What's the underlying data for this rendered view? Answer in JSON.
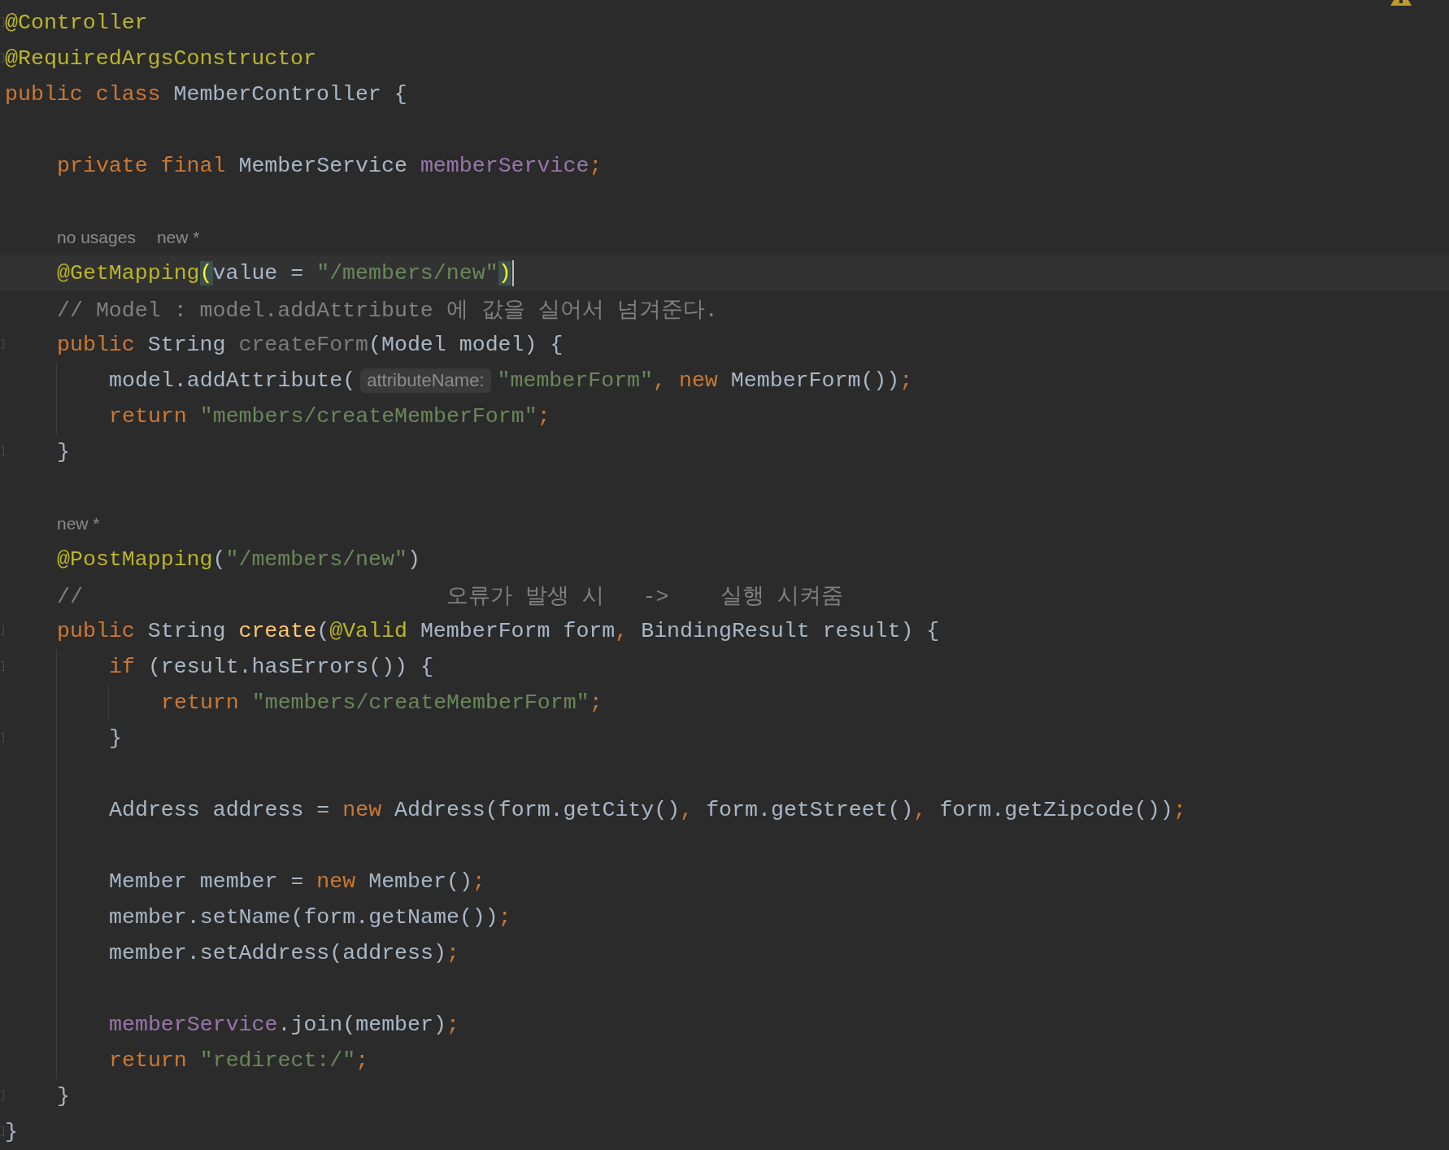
{
  "lines": [
    {
      "kind": "code",
      "fold": true,
      "tokens": [
        {
          "kind": "annotation",
          "text": "@Controller"
        }
      ]
    },
    {
      "kind": "code",
      "fold": true,
      "tokens": [
        {
          "kind": "annotation",
          "text": "@RequiredArgsConstructor"
        }
      ]
    },
    {
      "kind": "code",
      "tokens": [
        {
          "kind": "keyword",
          "text": "public class "
        },
        {
          "kind": "plain",
          "text": "MemberController {"
        }
      ],
      "children": [
        {
          "kind": "blank"
        },
        {
          "kind": "code",
          "tokens": [
            {
              "kind": "keyword",
              "text": "private final "
            },
            {
              "kind": "plain",
              "text": "MemberService "
            },
            {
              "kind": "field",
              "text": "memberService"
            },
            {
              "kind": "keyword",
              "text": ";"
            }
          ]
        },
        {
          "kind": "blank"
        },
        {
          "kind": "hint",
          "items": [
            "no usages",
            "new *"
          ]
        },
        {
          "kind": "code",
          "current": true,
          "tokens": [
            {
              "kind": "annotation",
              "text": "@GetMapping"
            },
            {
              "kind": "match",
              "text": "("
            },
            {
              "kind": "plain",
              "text": "value = "
            },
            {
              "kind": "string",
              "text": "\"/members/new\""
            },
            {
              "kind": "match",
              "text": ")"
            }
          ]
        },
        {
          "kind": "code",
          "tokens": [
            {
              "kind": "comment",
              "text": "// Model : model.addAttribute 에 값을 실어서 넘겨준다."
            }
          ]
        },
        {
          "kind": "code",
          "fold": true,
          "tokens": [
            {
              "kind": "keyword",
              "text": "public "
            },
            {
              "kind": "plain",
              "text": "String "
            },
            {
              "kind": "unused",
              "text": "createForm"
            },
            {
              "kind": "plain",
              "text": "(Model model) {"
            }
          ],
          "children": [
            {
              "kind": "code",
              "tokens": [
                {
                  "kind": "plain",
                  "text": "model.addAttribute("
                },
                {
                  "kind": "inlay",
                  "text": "attributeName:"
                },
                {
                  "kind": "string",
                  "text": "\"memberForm\""
                },
                {
                  "kind": "keyword",
                  "text": ", new "
                },
                {
                  "kind": "plain",
                  "text": "MemberForm())"
                },
                {
                  "kind": "keyword",
                  "text": ";"
                }
              ]
            },
            {
              "kind": "code",
              "tokens": [
                {
                  "kind": "keyword",
                  "text": "return "
                },
                {
                  "kind": "string",
                  "text": "\"members/createMemberForm\""
                },
                {
                  "kind": "keyword",
                  "text": ";"
                }
              ]
            }
          ]
        },
        {
          "kind": "code",
          "fold": true,
          "tokens": [
            {
              "kind": "plain",
              "text": "}"
            }
          ]
        },
        {
          "kind": "blank"
        },
        {
          "kind": "hint",
          "items": [
            "new *"
          ]
        },
        {
          "kind": "code",
          "tokens": [
            {
              "kind": "annotation",
              "text": "@PostMapping"
            },
            {
              "kind": "plain",
              "text": "("
            },
            {
              "kind": "string",
              "text": "\"/members/new\""
            },
            {
              "kind": "plain",
              "text": ")"
            }
          ]
        },
        {
          "kind": "code",
          "tokens": [
            {
              "kind": "comment",
              "text": "//                            오류가 발생 시   ->    실행 시켜줌"
            }
          ]
        },
        {
          "kind": "code",
          "fold": true,
          "tokens": [
            {
              "kind": "keyword",
              "text": "public "
            },
            {
              "kind": "plain",
              "text": "String "
            },
            {
              "kind": "declaration",
              "text": "create"
            },
            {
              "kind": "plain",
              "text": "("
            },
            {
              "kind": "annotation",
              "text": "@Valid"
            },
            {
              "kind": "plain",
              "text": " MemberForm form"
            },
            {
              "kind": "keyword",
              "text": ", "
            },
            {
              "kind": "plain",
              "text": "BindingResult result) {"
            }
          ],
          "children": [
            {
              "kind": "code",
              "fold": true,
              "tokens": [
                {
                  "kind": "keyword",
                  "text": "if "
                },
                {
                  "kind": "plain",
                  "text": "(result.hasErrors()) {"
                }
              ],
              "children": [
                {
                  "kind": "code",
                  "tokens": [
                    {
                      "kind": "keyword",
                      "text": "return "
                    },
                    {
                      "kind": "string",
                      "text": "\"members/createMemberForm\""
                    },
                    {
                      "kind": "keyword",
                      "text": ";"
                    }
                  ]
                }
              ]
            },
            {
              "kind": "code",
              "fold": true,
              "tokens": [
                {
                  "kind": "plain",
                  "text": "}"
                }
              ]
            },
            {
              "kind": "blank"
            },
            {
              "kind": "code",
              "tokens": [
                {
                  "kind": "plain",
                  "text": "Address address = "
                },
                {
                  "kind": "keyword",
                  "text": "new "
                },
                {
                  "kind": "plain",
                  "text": "Address(form.getCity()"
                },
                {
                  "kind": "keyword",
                  "text": ", "
                },
                {
                  "kind": "plain",
                  "text": "form.getStreet()"
                },
                {
                  "kind": "keyword",
                  "text": ", "
                },
                {
                  "kind": "plain",
                  "text": "form.getZipcode())"
                },
                {
                  "kind": "keyword",
                  "text": ";"
                }
              ]
            },
            {
              "kind": "blank"
            },
            {
              "kind": "code",
              "tokens": [
                {
                  "kind": "plain",
                  "text": "Member member = "
                },
                {
                  "kind": "keyword",
                  "text": "new "
                },
                {
                  "kind": "plain",
                  "text": "Member()"
                },
                {
                  "kind": "keyword",
                  "text": ";"
                }
              ]
            },
            {
              "kind": "code",
              "tokens": [
                {
                  "kind": "plain",
                  "text": "member.setName(form.getName())"
                },
                {
                  "kind": "keyword",
                  "text": ";"
                }
              ]
            },
            {
              "kind": "code",
              "tokens": [
                {
                  "kind": "plain",
                  "text": "member.setAddress(address)"
                },
                {
                  "kind": "keyword",
                  "text": ";"
                }
              ]
            },
            {
              "kind": "blank"
            },
            {
              "kind": "code",
              "tokens": [
                {
                  "kind": "field",
                  "text": "memberService"
                },
                {
                  "kind": "plain",
                  "text": ".join(member)"
                },
                {
                  "kind": "keyword",
                  "text": ";"
                }
              ]
            },
            {
              "kind": "code",
              "tokens": [
                {
                  "kind": "keyword",
                  "text": "return "
                },
                {
                  "kind": "string",
                  "text": "\"redirect:/\""
                },
                {
                  "kind": "keyword",
                  "text": ";"
                }
              ]
            }
          ]
        },
        {
          "kind": "code",
          "fold": true,
          "tokens": [
            {
              "kind": "plain",
              "text": "}"
            }
          ]
        }
      ]
    },
    {
      "kind": "code",
      "fold": true,
      "tokens": [
        {
          "kind": "plain",
          "text": "}"
        }
      ]
    }
  ]
}
